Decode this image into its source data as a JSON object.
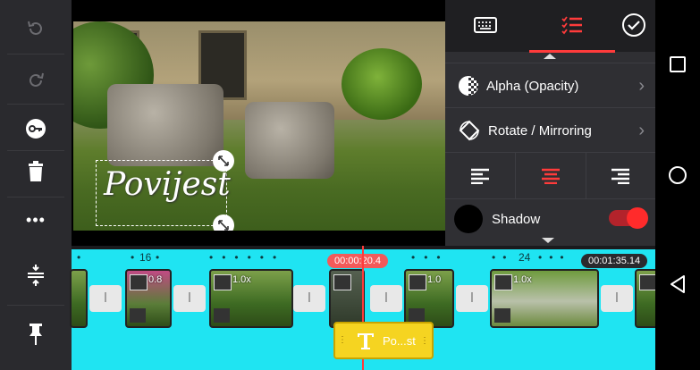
{
  "toolbar_left": {
    "items": [
      {
        "icon": "undo-icon"
      },
      {
        "icon": "redo-icon"
      },
      {
        "icon": "keyframe-icon"
      },
      {
        "icon": "trash-icon"
      },
      {
        "icon": "more-icon",
        "label": "•••"
      }
    ]
  },
  "preview": {
    "overlay_text": "Povijest"
  },
  "panel": {
    "tabs": [
      {
        "icon": "keyboard-icon"
      },
      {
        "icon": "checklist-icon"
      },
      {
        "icon": "checkmark-icon"
      }
    ],
    "alpha_label": "Alpha (Opacity)",
    "rotate_label": "Rotate / Mirroring",
    "shadow_label": "Shadow",
    "shadow_enabled": true,
    "accent": "#ff3b3b"
  },
  "timeline": {
    "playhead_time": "00:00:20.4",
    "total_time": "00:01:35.14",
    "ruler_marks": [
      "16",
      "24"
    ],
    "clips": [
      {
        "speed": ""
      },
      {
        "speed": "0.8"
      },
      {
        "speed": "1.0x"
      },
      {
        "speed": ""
      },
      {
        "speed": "1.0"
      },
      {
        "speed": "1.0x"
      },
      {
        "speed": ""
      }
    ],
    "text_clip_label": "Po...st",
    "track_color": "#1fe4f2"
  },
  "nav": [
    "square-icon",
    "circle-icon",
    "back-triangle-icon"
  ]
}
